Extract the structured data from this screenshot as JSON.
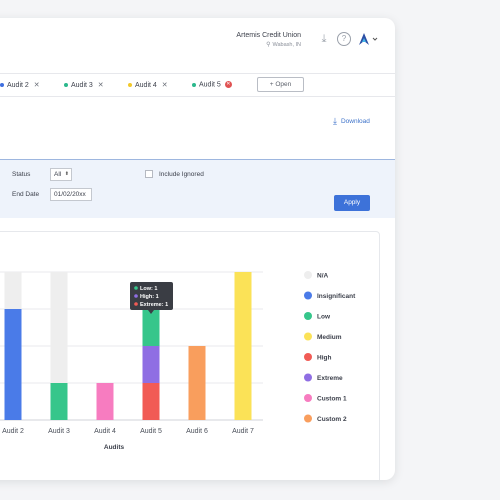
{
  "header": {
    "org_name": "Artemis Credit Union",
    "org_location": "Wabash, IN"
  },
  "tabs": [
    {
      "label": "Audit 2",
      "color": "#3f6fe0"
    },
    {
      "label": "Audit 3",
      "color": "#2bb88c"
    },
    {
      "label": "Audit 4",
      "color": "#f2c82a"
    },
    {
      "label": "Audit 5",
      "color": "#2bb88c"
    }
  ],
  "open_button": {
    "label": "+ Open"
  },
  "download": {
    "label": "Download"
  },
  "filters": {
    "status_label": "Status",
    "status_value": "All",
    "end_date_label": "End Date",
    "end_date_value": "01/02/20xx",
    "include_ignored_label": "Include Ignored",
    "apply_label": "Apply"
  },
  "chart_data": {
    "type": "bar",
    "xlabel": "Audits",
    "categories": [
      "Audit 2",
      "Audit 3",
      "Audit 4",
      "Audit 5",
      "Audit 6",
      "Audit 7"
    ],
    "ylim": [
      0,
      4
    ],
    "series": [
      {
        "name": "N/A",
        "color": "#eeeeee",
        "values": [
          1,
          3,
          0,
          0,
          0,
          0
        ]
      },
      {
        "name": "Insignificant",
        "color": "#4a7be8",
        "values": [
          3,
          0,
          0,
          0,
          0,
          0
        ]
      },
      {
        "name": "Low",
        "color": "#36c68b",
        "values": [
          0,
          1,
          0,
          1,
          0,
          0
        ]
      },
      {
        "name": "Medium",
        "color": "#fbe257",
        "values": [
          0,
          0,
          0,
          0,
          0,
          4
        ]
      },
      {
        "name": "High",
        "color": "#f15b55",
        "values": [
          0,
          0,
          0,
          1,
          0,
          0
        ]
      },
      {
        "name": "Extreme",
        "color": "#8f6ee3",
        "values": [
          0,
          0,
          0,
          1,
          0,
          0
        ]
      },
      {
        "name": "Custom 1",
        "color": "#f77cc0",
        "values": [
          0,
          0,
          1,
          0,
          0,
          0
        ]
      },
      {
        "name": "Custom 2",
        "color": "#f99e5d",
        "values": [
          0,
          0,
          0,
          0,
          2,
          0
        ]
      }
    ],
    "stack_order": [
      "High",
      "Extreme",
      "Low",
      "Custom 1",
      "Custom 2",
      "Medium",
      "Insignificant",
      "N/A"
    ],
    "tooltip": {
      "category": "Audit 5",
      "lines": [
        {
          "label": "Low: 1",
          "color": "#36c68b"
        },
        {
          "label": "High: 1",
          "color": "#8f6ee3"
        },
        {
          "label": "Extreme: 1",
          "color": "#f15b55"
        }
      ]
    }
  }
}
